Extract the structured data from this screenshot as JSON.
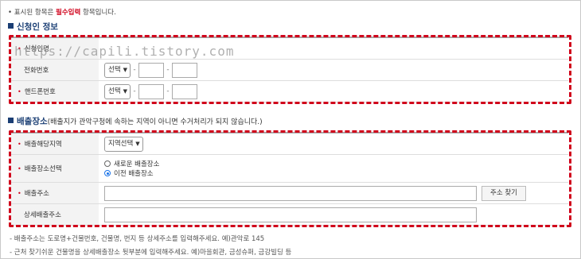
{
  "notice": {
    "prefix": "• 표시된 항목은",
    "required": "필수입력",
    "suffix": "항목입니다."
  },
  "applicant": {
    "title": "신청인 정보",
    "rows": [
      {
        "label": "신청인명"
      },
      {
        "label": "전화번호",
        "select": "선택"
      },
      {
        "label": "핸드폰번호",
        "select": "선택"
      }
    ]
  },
  "watermark": "https://capili.tistory.com",
  "discharge": {
    "title": "배출장소",
    "subtitle": "(배출지가 관악구청에 속하는 지역이 아니면 수거처리가 되지 않습니다.)",
    "rows": {
      "area_label": "배출해당지역",
      "area_select": "지역선택",
      "place_label": "배출장소선택",
      "radio_new": "새로운 배출장소",
      "radio_prev": "이전 배출장소",
      "address_label": "배출주소",
      "address_button": "주소 찾기",
      "detail_label": "상세배출주소"
    }
  },
  "notes": [
    "- 배출주소는 도로명+건물번호, 건물명, 번지 등 상세주소를 입력해주세요. 예)관악로 145",
    "- 근처 찾기쉬운 건물명을 상세배출장소 뒷부분에 입력해주세요. 예)마을회관, 금성슈퍼, 금강빌딩 등"
  ],
  "colors": {
    "accent": "#1a3e74",
    "required": "#d0021b",
    "radio_selected": "#1a73e8"
  }
}
